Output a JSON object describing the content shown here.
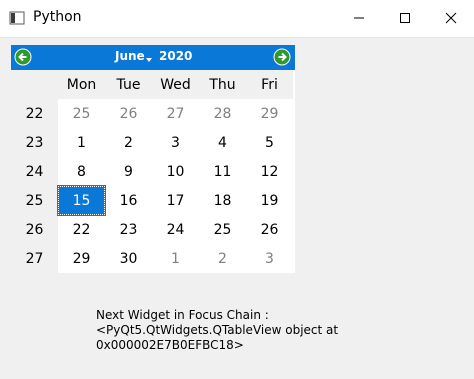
{
  "window": {
    "title": "Python",
    "minimize_icon": "minimize-icon",
    "maximize_icon": "maximize-icon",
    "close_icon": "close-icon"
  },
  "calendar": {
    "month": "June",
    "year": "2020",
    "prev_icon": "arrow-left-circle-icon",
    "next_icon": "arrow-right-circle-icon",
    "accent_color": "#0a78d7",
    "day_headers": [
      "Mon",
      "Tue",
      "Wed",
      "Thu",
      "Fri"
    ],
    "week_numbers": [
      "22",
      "23",
      "24",
      "25",
      "26",
      "27"
    ],
    "rows": [
      [
        "25",
        "26",
        "27",
        "28",
        "29"
      ],
      [
        "1",
        "2",
        "3",
        "4",
        "5"
      ],
      [
        "8",
        "9",
        "10",
        "11",
        "12"
      ],
      [
        "15",
        "16",
        "17",
        "18",
        "19"
      ],
      [
        "22",
        "23",
        "24",
        "25",
        "26"
      ],
      [
        "29",
        "30",
        "1",
        "2",
        "3"
      ]
    ],
    "selected_day": "15"
  },
  "focus_info": {
    "line1": "Next Widget in Focus Chain :",
    "line2": "<PyQt5.QtWidgets.QTableView object at",
    "line3": "0x000002E7B0EFBC18>"
  }
}
